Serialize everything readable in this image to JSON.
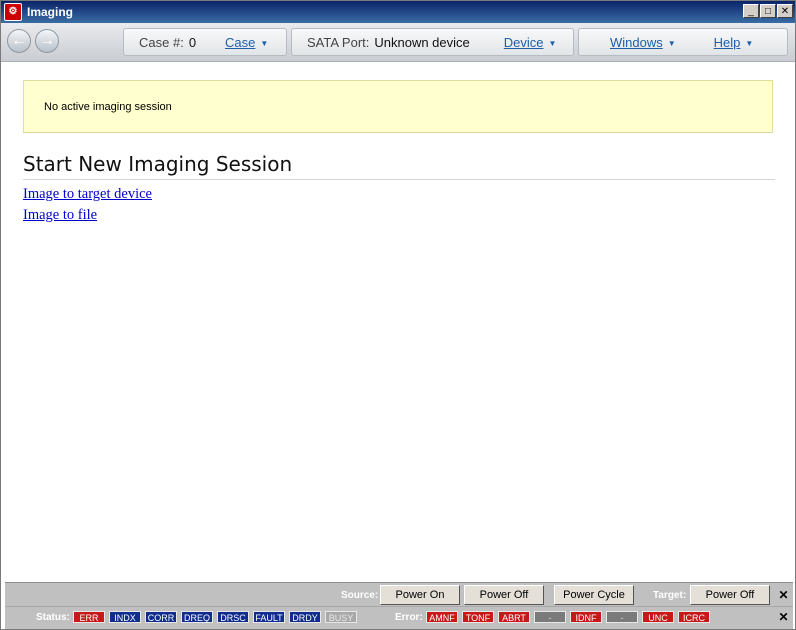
{
  "window": {
    "title": "Imaging"
  },
  "toolbar": {
    "case_label": "Case #:",
    "case_value": "0",
    "case_menu": "Case",
    "port_label": "SATA Port:",
    "port_value": "Unknown device",
    "device_menu": "Device",
    "windows_menu": "Windows",
    "help_menu": "Help"
  },
  "notice": {
    "text": "No active imaging session"
  },
  "main": {
    "heading": "Start New Imaging Session",
    "links": [
      "Image to target device",
      "Image to file"
    ]
  },
  "power": {
    "source_label": "Source:",
    "source_buttons": [
      "Power On",
      "Power Off",
      "Power Cycle"
    ],
    "target_label": "Target:",
    "target_button": "Power Off"
  },
  "status": {
    "status_label": "Status:",
    "status_flags": [
      "ERR",
      "INDX",
      "CORR",
      "DREQ",
      "DRSC",
      "FAULT",
      "DRDY",
      "BUSY"
    ],
    "error_label": "Error:",
    "error_flags": [
      "AMNF",
      "TONF",
      "ABRT",
      "-",
      "IDNF",
      "-",
      "UNC",
      "ICRC"
    ]
  },
  "colors": {
    "status_blue": "#102c8f",
    "status_red": "#c81818",
    "notice_bg": "#ffffd0",
    "link": "#0000cc"
  }
}
